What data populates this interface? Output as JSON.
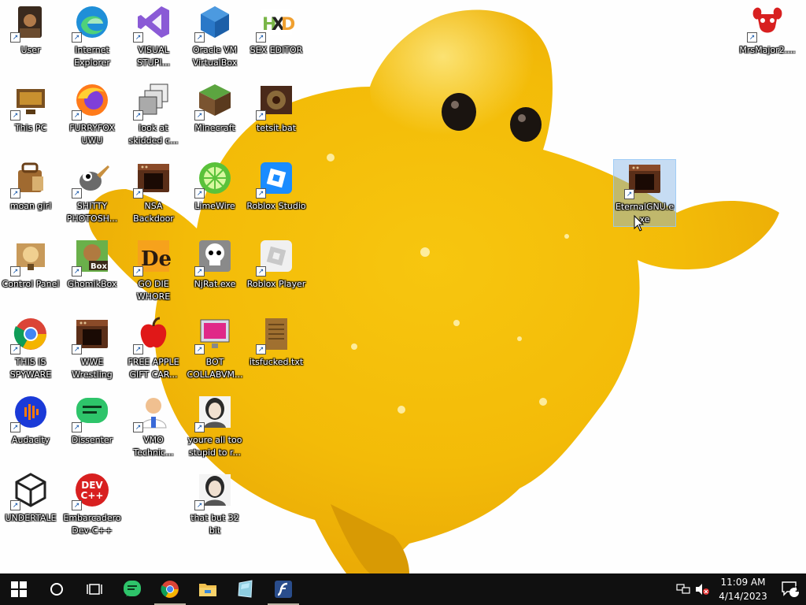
{
  "desktop": {
    "icons": [
      {
        "label": "User",
        "icon": "user-folder-icon",
        "col": 0,
        "row": 0
      },
      {
        "label": "Internet Explorer",
        "icon": "edge-icon",
        "col": 1,
        "row": 0
      },
      {
        "label": "VISUAL STUPI...",
        "icon": "visual-studio-icon",
        "col": 2,
        "row": 0
      },
      {
        "label": "Oracle VM VirtualBox",
        "icon": "virtualbox-icon",
        "col": 3,
        "row": 0
      },
      {
        "label": "SEX EDITOR",
        "icon": "hxd-icon",
        "col": 4,
        "row": 0
      },
      {
        "label": "This PC",
        "icon": "computer-icon",
        "col": 0,
        "row": 1
      },
      {
        "label": "FURRYFOX UWU",
        "icon": "firefox-icon",
        "col": 1,
        "row": 1
      },
      {
        "label": "look at skidded c...",
        "icon": "stacked-windows-icon",
        "col": 2,
        "row": 1
      },
      {
        "label": "Minecraft",
        "icon": "minecraft-icon",
        "col": 3,
        "row": 1
      },
      {
        "label": "tetsit.bat",
        "icon": "batch-file-icon",
        "col": 4,
        "row": 1
      },
      {
        "label": "moan girl",
        "icon": "bag-icon",
        "col": 0,
        "row": 2
      },
      {
        "label": "SHITTY PHOTOSH...",
        "icon": "gimp-icon",
        "col": 1,
        "row": 2
      },
      {
        "label": "NSA Backdoor",
        "icon": "program-icon",
        "col": 2,
        "row": 2
      },
      {
        "label": "LimeWire",
        "icon": "limewire-icon",
        "col": 3,
        "row": 2
      },
      {
        "label": "Roblox Studio",
        "icon": "roblox-studio-icon",
        "col": 4,
        "row": 2
      },
      {
        "label": "Control Panel",
        "icon": "control-panel-icon",
        "col": 0,
        "row": 3
      },
      {
        "label": "GhomikBox",
        "icon": "box-dog-icon",
        "col": 1,
        "row": 3
      },
      {
        "label": "GO DIE WHORE",
        "icon": "de-icon",
        "col": 2,
        "row": 3
      },
      {
        "label": "NjRat.exe",
        "icon": "skull-icon",
        "col": 3,
        "row": 3
      },
      {
        "label": "Roblox Player",
        "icon": "roblox-player-icon",
        "col": 4,
        "row": 3
      },
      {
        "label": "THIS IS SPYWARE",
        "icon": "chrome-icon",
        "col": 0,
        "row": 4
      },
      {
        "label": "WWE Wrestling",
        "icon": "program-icon",
        "col": 1,
        "row": 4
      },
      {
        "label": "FREE APPLE GIFT CAR...",
        "icon": "apple-icon",
        "col": 2,
        "row": 4
      },
      {
        "label": "BOT COLLABVM...",
        "icon": "monitor-icon",
        "col": 3,
        "row": 4
      },
      {
        "label": "itsfucked.txt",
        "icon": "text-file-icon",
        "col": 4,
        "row": 4
      },
      {
        "label": "Audacity",
        "icon": "audacity-icon",
        "col": 0,
        "row": 5
      },
      {
        "label": "Dissenter",
        "icon": "dissenter-icon",
        "col": 1,
        "row": 5
      },
      {
        "label": "VMO Technic...",
        "icon": "doctor-icon",
        "col": 2,
        "row": 5
      },
      {
        "label": "youre all too stupid to r...",
        "icon": "portrait-icon",
        "col": 3,
        "row": 5
      },
      {
        "label": "UNDERTALE",
        "icon": "unity-icon",
        "col": 0,
        "row": 6
      },
      {
        "label": "Embarcadero Dev-C++",
        "icon": "devcpp-icon",
        "col": 1,
        "row": 6
      },
      {
        "label": "that but 32 bit",
        "icon": "portrait-icon",
        "col": 3,
        "row": 6
      }
    ],
    "right_icons": [
      {
        "label": "MrsMajor2....",
        "icon": "goat-skull-icon"
      },
      {
        "label": "EternalGNU.exe",
        "icon": "program-icon",
        "selected": true
      }
    ]
  },
  "taskbar": {
    "start": "start-windows-icon",
    "search": "search-circle-icon",
    "taskview": "task-view-icon",
    "pinned": [
      {
        "icon": "dissenter-icon",
        "active": false
      },
      {
        "icon": "chrome-icon",
        "active": true
      },
      {
        "icon": "file-explorer-icon",
        "active": false
      },
      {
        "icon": "glass-app-icon",
        "active": false
      },
      {
        "icon": "flash-icon",
        "active": true
      }
    ],
    "clock": {
      "time": "11:09 AM",
      "date": "4/14/2023"
    },
    "notifications_count": "1"
  }
}
